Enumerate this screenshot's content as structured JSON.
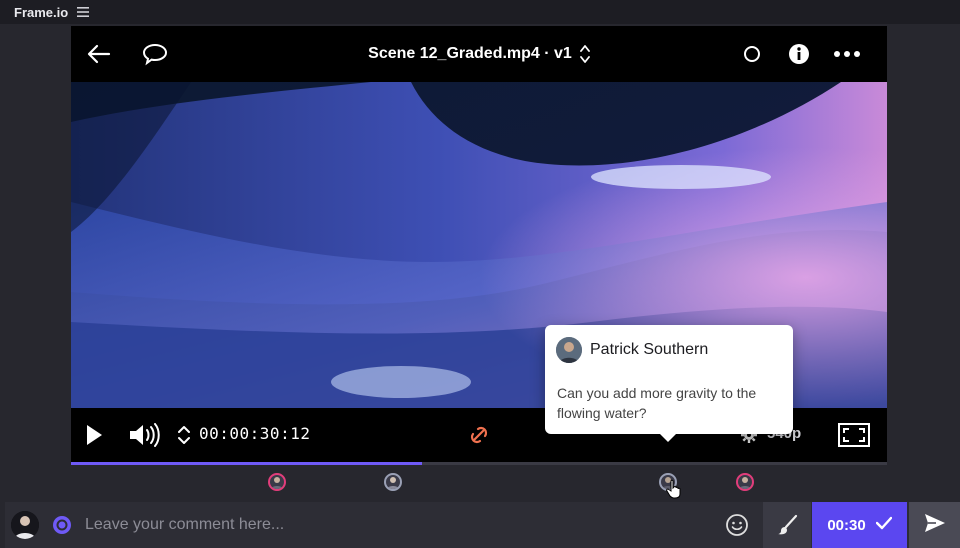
{
  "app": {
    "title": "Frame.io",
    "menu_icon": "hamburger-menu-icon"
  },
  "player": {
    "file_name": "Scene 12_Graded.mp4 · v1",
    "header_icons": [
      "back-arrow-icon",
      "comment-bubble-icon",
      "circle-status-icon",
      "info-icon",
      "more-icon"
    ],
    "controls": {
      "timecode": "00:00:30:12",
      "quality": "540p",
      "icons": [
        "play-icon",
        "volume-icon",
        "timecode-toggle-icon",
        "loop-icon",
        "settings-gear-icon",
        "fullscreen-icon"
      ]
    },
    "progress": 0.43,
    "accent_color": "#6f5af6",
    "marker_color": "#e23d7b"
  },
  "comment_popup": {
    "author": "Patrick Southern",
    "text": "Can you add more gravity to the flowing water?"
  },
  "comment_bar": {
    "placeholder": "Leave your comment here...",
    "timestamp": "00:30",
    "timestamp_bg": "#5b47f0",
    "icons": [
      "user-avatar",
      "mention-icon",
      "emoji-icon",
      "brush-icon",
      "check-icon",
      "send-icon"
    ]
  }
}
